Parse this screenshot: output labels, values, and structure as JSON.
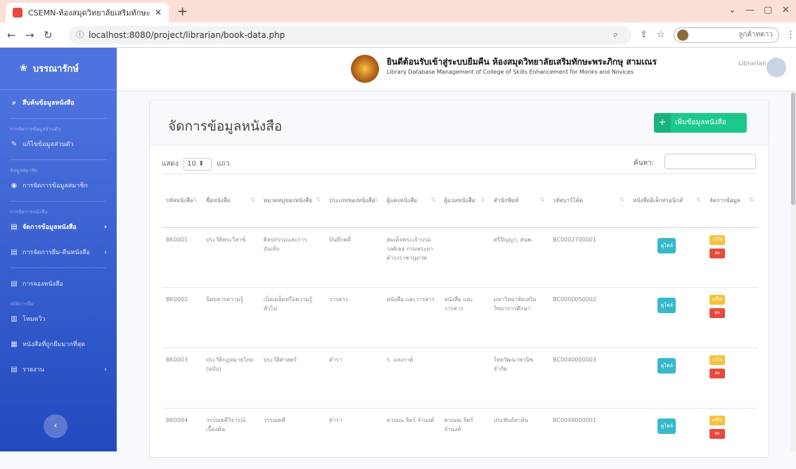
{
  "browser": {
    "tab_title": "CSEMN-ห้องสมุดวิทยาลัยเสริมทักษะ",
    "url": "localhost:8080/project/librarian/book-data.php",
    "profile_label": "ลูกค้าทดาว"
  },
  "sidebar": {
    "brand": "บรรณารักษ์",
    "items": [
      {
        "label": "สืบค้นข้อมูลหนังสือ",
        "kind": "link"
      },
      {
        "label": "การจัดการข้อมูลส่วนตัว",
        "kind": "heading"
      },
      {
        "label": "แก้ไขข้อมูลส่วนตัว",
        "kind": "link"
      },
      {
        "label": "ข้อมูลสมาชิก",
        "kind": "heading"
      },
      {
        "label": "การจัดการข้อมูลสมาชิก",
        "kind": "link"
      },
      {
        "label": "การจัดการหนังสือ",
        "kind": "heading"
      },
      {
        "label": "จัดการข้อมูลหนังสือ",
        "kind": "link"
      },
      {
        "label": "การจัดการยืม-คืนหนังสือ",
        "kind": "link"
      },
      {
        "label": "การจองหนังสือ",
        "kind": "link"
      },
      {
        "label": "สถิติการยืม",
        "kind": "heading"
      },
      {
        "label": "โหมดวิว",
        "kind": "link"
      },
      {
        "label": "หนังสือที่ถูกยืมมากที่สุด",
        "kind": "link"
      },
      {
        "label": "รายงาน",
        "kind": "link"
      }
    ]
  },
  "header": {
    "title": "ยินดีต้อนรับเข้าสู่ระบบยืมคืน ห้องสมุดวิทยาลัยเสริมทักษะพระภิกษุ สามเณร",
    "subtitle": "Library Database Management of College of Skills Enhancement for Monks and Novices",
    "user_role": "Librarian"
  },
  "main": {
    "title": "จัดการข้อมูลหนังสือ",
    "add_button": "เพิ่มข้อมูลหนังสือ",
    "show_prefix": "แสดง",
    "show_value": "10",
    "show_suffix": "แถว",
    "search_label": "ค้นหา:",
    "columns": [
      "รหัสหนังสือ",
      "ชื่อหนังสือ",
      "หมวดหมู่ของหนังสือ",
      "ประเภทของหนังสือ",
      "ผู้แต่งหนังสือ",
      "ผู้แปลหนังสือ",
      "สำนักพิมพ์",
      "รหัสบาร์โค้ด",
      "หนังสืออิเล็กทรอนิกส์",
      "จัดการข้อมูล"
    ],
    "view_label": "ดูไฟล์",
    "edit_label": "แก้ไข",
    "delete_label": "ลบ",
    "rows": [
      {
        "id": "BK0001",
        "name": "ประวัติพระวิสาข์",
        "category": "ศิลปกรรมและการบันเทิง",
        "type": "บันทึกคดี",
        "author": "สมเด็จพระเจ้าบรมวงศ์เธอ กรมพระยาดำรงราชานุภาพ",
        "translator": "",
        "publisher": "ศรีปัญญา, สนพ.",
        "barcode": "BC0002700001"
      },
      {
        "id": "BK0002",
        "name": "นิตยสารความรู้",
        "category": "เบ็ดเตล็ดหรือความรู้ทั่วไป",
        "type": "วารสาร",
        "author": "หนังสือ และวารสาร",
        "translator": "หนังสือ และวารสาร",
        "publisher": "มหาวิทยาลัยเสริมวิทยาการศึกษา",
        "barcode": "BC0000050002"
      },
      {
        "id": "BK0003",
        "name": "ประวัติกฎหมายไทย (ฉบับ)",
        "category": "ประวัติศาสตร์",
        "type": "ตำรา",
        "author": "ร. แลงกาต์",
        "translator": "",
        "publisher": "ไทยวัฒนาพานิช จำกัด",
        "barcode": "BC0040000003"
      },
      {
        "id": "BK0004",
        "name": "วรรณคดีวิจารณ์เบื้องต้น",
        "category": "วรรณคดี",
        "type": "ตำรา",
        "author": "ควณณ จิตร์ จำนงค์",
        "translator": "ควณณ จิตร์ จำนงค์",
        "publisher": "ประพันธ์สาส์น",
        "barcode": "BC0048000001"
      }
    ]
  },
  "colors": {
    "sidebar": "#4e73df",
    "success": "#1cc88a",
    "info": "#36b9cc",
    "warning": "#f6c23e",
    "danger": "#e74a3b"
  }
}
